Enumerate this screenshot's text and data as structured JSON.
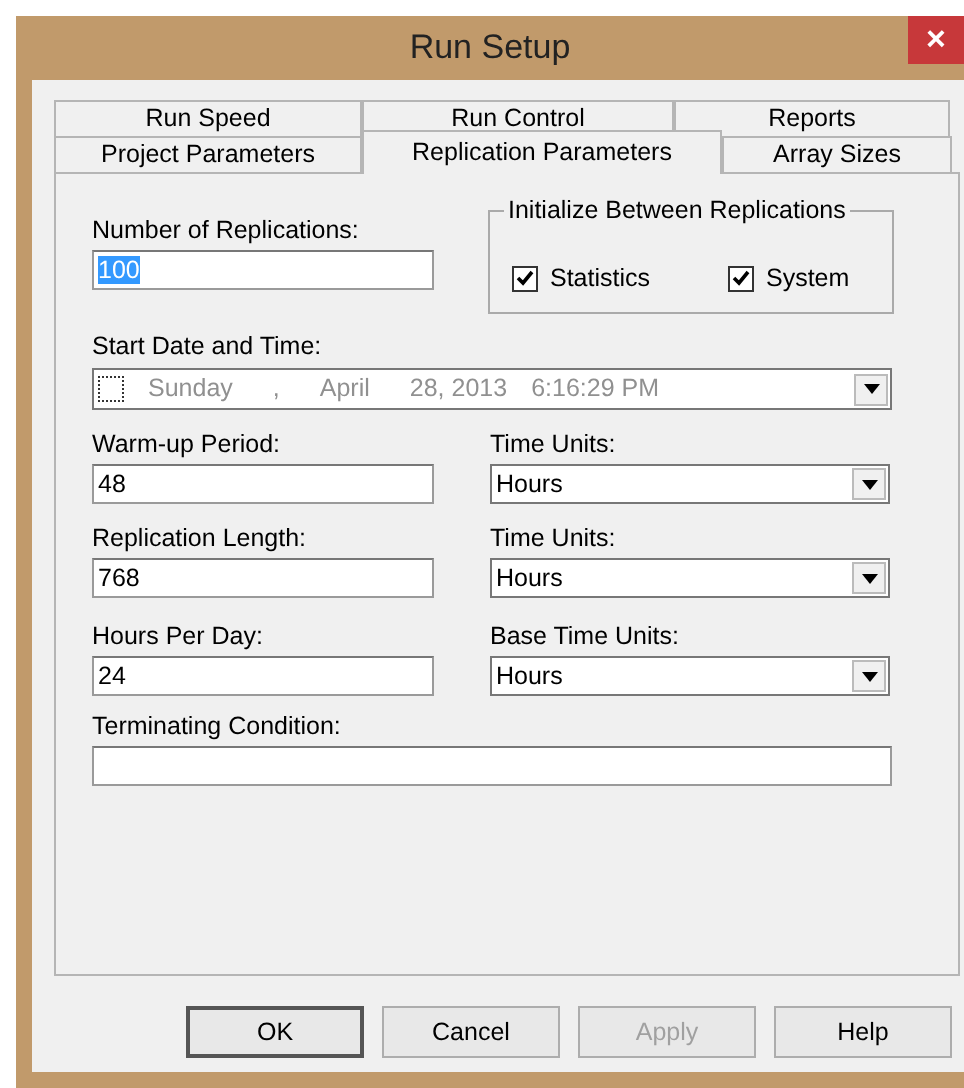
{
  "window": {
    "title": "Run Setup",
    "close_button": "×"
  },
  "tab_rows": [
    [
      {
        "label": "Run Speed",
        "selected": false
      },
      {
        "label": "Run Control",
        "selected": false
      },
      {
        "label": "Reports",
        "selected": false
      }
    ],
    [
      {
        "label": "Project Parameters",
        "selected": false
      },
      {
        "label": "Replication Parameters",
        "selected": true
      },
      {
        "label": "Array Sizes",
        "selected": false
      }
    ]
  ],
  "number_of_replications": {
    "label": "Number of Replications:",
    "value": "100",
    "text_selected": true
  },
  "initialize_group": {
    "title": "Initialize Between Replications",
    "checkboxes": [
      {
        "label": "Statistics",
        "checked": true
      },
      {
        "label": "System",
        "checked": true
      }
    ]
  },
  "start_date": {
    "label": "Start Date and Time:",
    "checked": false,
    "parts": [
      "Sunday",
      ",",
      "April",
      "28, 2013",
      "6:16:29 PM"
    ]
  },
  "rows": [
    {
      "label": "Warm-up Period:",
      "value": "48",
      "unit_label": "Time Units:",
      "unit": "Hours"
    },
    {
      "label": "Replication Length:",
      "value": "768",
      "unit_label": "Time Units:",
      "unit": "Hours"
    },
    {
      "label": "Hours Per Day:",
      "value": "24",
      "unit_label": "Base Time Units:",
      "unit": "Hours"
    }
  ],
  "terminating_condition": {
    "label": "Terminating Condition:"
  },
  "buttons": [
    {
      "label": "OK",
      "default": true,
      "disabled": false
    },
    {
      "label": "Cancel",
      "default": false,
      "disabled": false
    },
    {
      "label": "Apply",
      "default": false,
      "disabled": true
    },
    {
      "label": "Help",
      "default": false,
      "disabled": false
    }
  ]
}
